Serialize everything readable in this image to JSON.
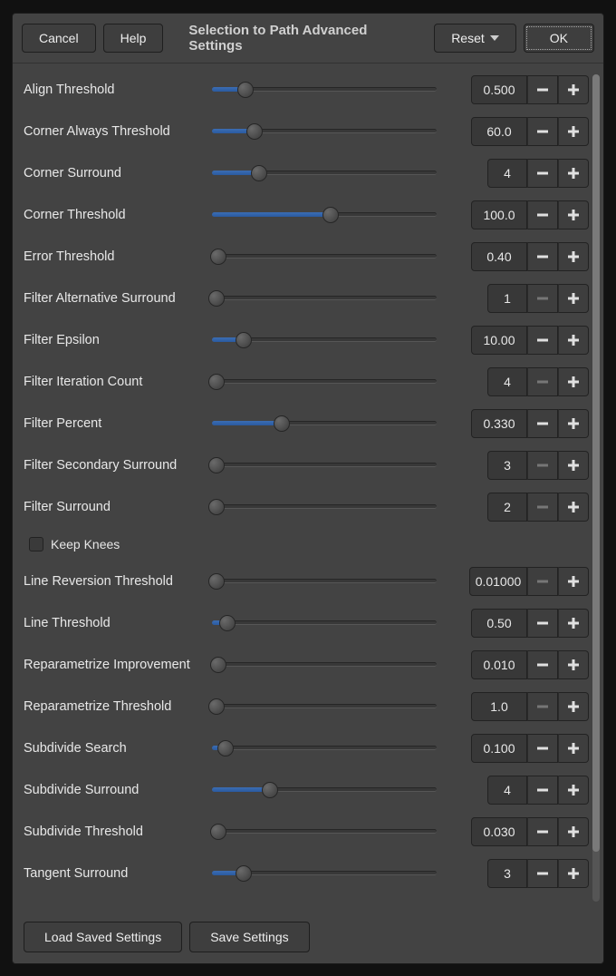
{
  "header": {
    "cancel": "Cancel",
    "help": "Help",
    "title": "Selection to Path Advanced Settings",
    "reset": "Reset",
    "ok": "OK"
  },
  "footer": {
    "load": "Load Saved Settings",
    "save": "Save Settings"
  },
  "checkbox": {
    "keep_knees": "Keep Knees"
  },
  "params": [
    {
      "id": "align-threshold",
      "label": "Align Threshold",
      "value": "0.500",
      "pct": 15,
      "narrow": false,
      "minus_disabled": false
    },
    {
      "id": "corner-always-threshold",
      "label": "Corner Always Threshold",
      "value": "60.0",
      "pct": 19,
      "narrow": false,
      "minus_disabled": false
    },
    {
      "id": "corner-surround",
      "label": "Corner Surround",
      "value": "4",
      "pct": 21,
      "narrow": true,
      "minus_disabled": false
    },
    {
      "id": "corner-threshold",
      "label": "Corner Threshold",
      "value": "100.0",
      "pct": 53,
      "narrow": false,
      "minus_disabled": false
    },
    {
      "id": "error-threshold",
      "label": "Error Threshold",
      "value": "0.40",
      "pct": 3,
      "narrow": false,
      "minus_disabled": false
    },
    {
      "id": "filter-alternative-surround",
      "label": "Filter Alternative Surround",
      "value": "1",
      "pct": 2,
      "narrow": true,
      "minus_disabled": true
    },
    {
      "id": "filter-epsilon",
      "label": "Filter Epsilon",
      "value": "10.00",
      "pct": 14,
      "narrow": false,
      "minus_disabled": false
    },
    {
      "id": "filter-iteration-count",
      "label": "Filter Iteration Count",
      "value": "4",
      "pct": 2,
      "narrow": true,
      "minus_disabled": true
    },
    {
      "id": "filter-percent",
      "label": "Filter Percent",
      "value": "0.330",
      "pct": 31,
      "narrow": false,
      "minus_disabled": false
    },
    {
      "id": "filter-secondary-surround",
      "label": "Filter Secondary Surround",
      "value": "3",
      "pct": 2,
      "narrow": true,
      "minus_disabled": true
    },
    {
      "id": "filter-surround",
      "label": "Filter Surround",
      "value": "2",
      "pct": 2,
      "narrow": true,
      "minus_disabled": true
    },
    {
      "id": "line-reversion-threshold",
      "label": "Line Reversion Threshold",
      "value": "0.01000",
      "pct": 2,
      "narrow": false,
      "minus_disabled": true
    },
    {
      "id": "line-threshold",
      "label": "Line Threshold",
      "value": "0.50",
      "pct": 7,
      "narrow": false,
      "minus_disabled": false
    },
    {
      "id": "reparametrize-improvement",
      "label": "Reparametrize Improvement",
      "value": "0.010",
      "pct": 3,
      "narrow": false,
      "minus_disabled": false
    },
    {
      "id": "reparametrize-threshold",
      "label": "Reparametrize Threshold",
      "value": "1.0",
      "pct": 2,
      "narrow": false,
      "minus_disabled": true
    },
    {
      "id": "subdivide-search",
      "label": "Subdivide Search",
      "value": "0.100",
      "pct": 6,
      "narrow": false,
      "minus_disabled": false
    },
    {
      "id": "subdivide-surround",
      "label": "Subdivide Surround",
      "value": "4",
      "pct": 26,
      "narrow": true,
      "minus_disabled": false
    },
    {
      "id": "subdivide-threshold",
      "label": "Subdivide Threshold",
      "value": "0.030",
      "pct": 3,
      "narrow": false,
      "minus_disabled": false
    },
    {
      "id": "tangent-surround",
      "label": "Tangent Surround",
      "value": "3",
      "pct": 14,
      "narrow": true,
      "minus_disabled": false
    }
  ]
}
